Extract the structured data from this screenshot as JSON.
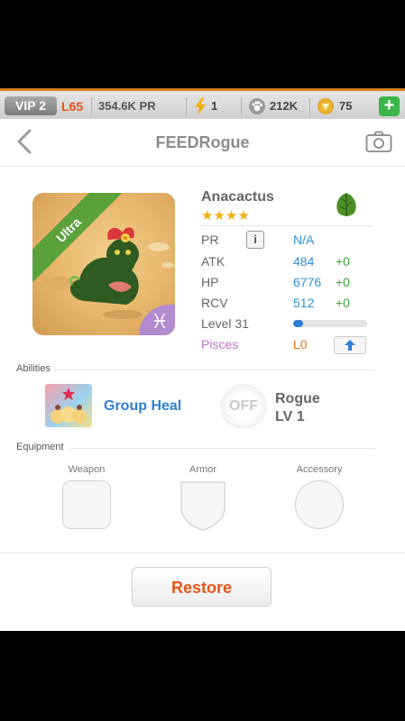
{
  "top_bar": {
    "vip": "VIP 2",
    "level": "L65",
    "power": "354.6K PR",
    "energy": "1",
    "food": "212K",
    "gold": "75",
    "add_label": "+"
  },
  "header": {
    "title": "FEEDRogue"
  },
  "monster": {
    "name": "Anacactus",
    "rarity": "Ultra",
    "stars": "★★★★",
    "star_count": 4,
    "element_icon": "leaf-icon",
    "sign_symbol": "♓",
    "stats": {
      "pr_label": "PR",
      "pr_value": "N/A",
      "info_label": "i",
      "atk_label": "ATK",
      "atk_value": "484",
      "atk_bonus": "+0",
      "hp_label": "HP",
      "hp_value": "6776",
      "hp_bonus": "+0",
      "rcv_label": "RCV",
      "rcv_value": "512",
      "rcv_bonus": "+0",
      "level_label": "Level 31",
      "level_progress": 0.14,
      "sign_label": "Pisces",
      "sign_level": "L0"
    }
  },
  "abilities": {
    "section_label": "Abilities",
    "skill_name": "Group Heal",
    "leader_state": "OFF",
    "leader_name": "Rogue",
    "leader_level": "LV 1"
  },
  "equipment": {
    "section_label": "Equipment",
    "weapon_label": "Weapon",
    "armor_label": "Armor",
    "accessory_label": "Accessory"
  },
  "actions": {
    "restore_label": "Restore"
  },
  "colors": {
    "accent_orange": "#e8541a",
    "value_blue": "#2e8fd6",
    "bonus_green": "#3aa53a",
    "pisces_purple": "#c46fd0",
    "element_green": "#4f8f2a"
  }
}
